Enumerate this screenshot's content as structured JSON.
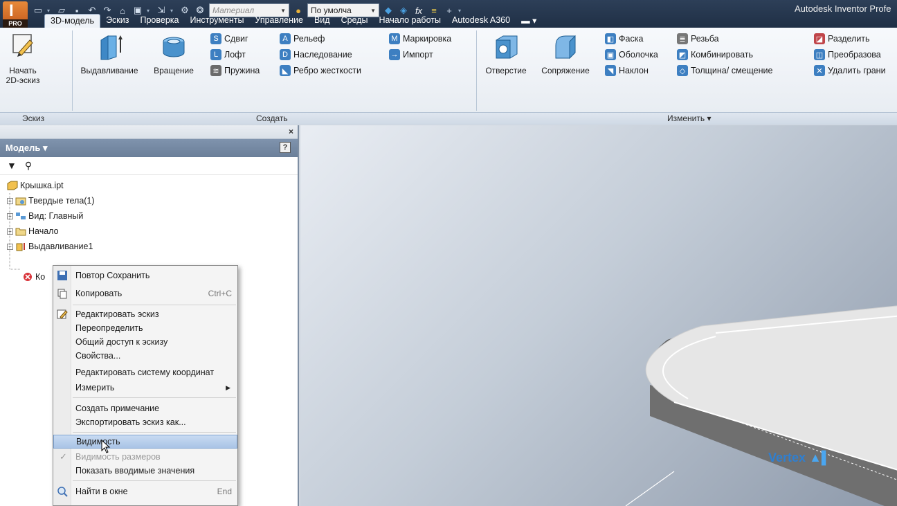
{
  "app": {
    "logo_text": "PRO",
    "logo_letter": "I",
    "title": "Autodesk Inventor Profe"
  },
  "quick_access": {
    "icons": [
      "new-icon",
      "open-icon",
      "save-icon",
      "undo-icon",
      "redo-icon",
      "home-icon",
      "image-icon",
      "select-icon",
      "update-icon",
      "appearance-icon"
    ],
    "material_combo": "Материал",
    "appearance_combo": "По умолча",
    "formula_label": "fx"
  },
  "tabs": [
    {
      "label": "3D-модель",
      "active": true
    },
    {
      "label": "Эскиз"
    },
    {
      "label": "Проверка"
    },
    {
      "label": "Инструменты"
    },
    {
      "label": "Управление"
    },
    {
      "label": "Вид"
    },
    {
      "label": "Среды"
    },
    {
      "label": "Начало работы"
    },
    {
      "label": "Autodesk A360"
    }
  ],
  "ribbon": {
    "sketch": {
      "start_line1": "Начать",
      "start_line2": "2D-эскиз",
      "panel_label": "Эскиз"
    },
    "create": {
      "panel_label": "Создать",
      "extrude": "Выдавливание",
      "revolve": "Вращение",
      "sweep": "Сдвиг",
      "loft": "Лофт",
      "coil": "Пружина",
      "emboss": "Рельеф",
      "derive": "Наследование",
      "rib": "Ребро жесткости",
      "mark": "Маркировка",
      "import": "Импорт"
    },
    "modify": {
      "panel_label": "Изменить ▾",
      "hole": "Отверстие",
      "fillet": "Сопряжение",
      "chamfer": "Фаска",
      "shell": "Оболочка",
      "draft": "Наклон",
      "thread": "Резьба",
      "combine": "Комбинировать",
      "thicken": "Толщина/ смещение",
      "split": "Разделить",
      "direct": "Преобразова",
      "delete_face": "Удалить грани"
    }
  },
  "browser": {
    "title": "Модель ▾",
    "help": "?",
    "close": "×",
    "tree": [
      {
        "label": "Крышка.ipt",
        "level": 0,
        "expander": ""
      },
      {
        "label": "Твердые тела(1)",
        "level": 0,
        "expander": "+"
      },
      {
        "label": "Вид: Главный",
        "level": 0,
        "expander": "+"
      },
      {
        "label": "Начало",
        "level": 0,
        "expander": "+"
      },
      {
        "label": "Выдавливание1",
        "level": 0,
        "expander": "−"
      },
      {
        "label": "",
        "level": 1,
        "expander": ""
      },
      {
        "label": "Ко",
        "level": 0,
        "expander": ""
      }
    ]
  },
  "context_menu": {
    "items": [
      {
        "label": "Повтор Сохранить",
        "icon": "save-icon",
        "shortcut": ""
      },
      {
        "label": "Копировать",
        "icon": "copy-icon",
        "shortcut": "Ctrl+C"
      },
      {
        "label": "Редактировать эскиз",
        "icon": "edit-sketch-icon",
        "shortcut": ""
      },
      {
        "label": "Переопределить",
        "shortcut": ""
      },
      {
        "label": "Общий доступ к эскизу",
        "shortcut": ""
      },
      {
        "label": "Свойства...",
        "shortcut": ""
      },
      {
        "label": "Редактировать систему координат",
        "shortcut": ""
      },
      {
        "label": "Измерить",
        "shortcut": "",
        "submenu": "▶"
      },
      {
        "label": "Создать примечание",
        "shortcut": ""
      },
      {
        "label": "Экспортировать эскиз как...",
        "shortcut": ""
      },
      {
        "label": "Видимость",
        "shortcut": "",
        "highlighted": true
      },
      {
        "label": "Видимость размеров",
        "shortcut": "",
        "disabled": true,
        "check": "✓"
      },
      {
        "label": "Показать вводимые значения",
        "shortcut": ""
      },
      {
        "label": "Найти в окне",
        "icon": "find-icon",
        "shortcut": "End"
      }
    ]
  },
  "viewport": {
    "watermark": "Vertex"
  },
  "colors": {
    "accent": "#2d3f58",
    "highlight": "#a9c4e6",
    "part_face": "#e4e4e4"
  }
}
